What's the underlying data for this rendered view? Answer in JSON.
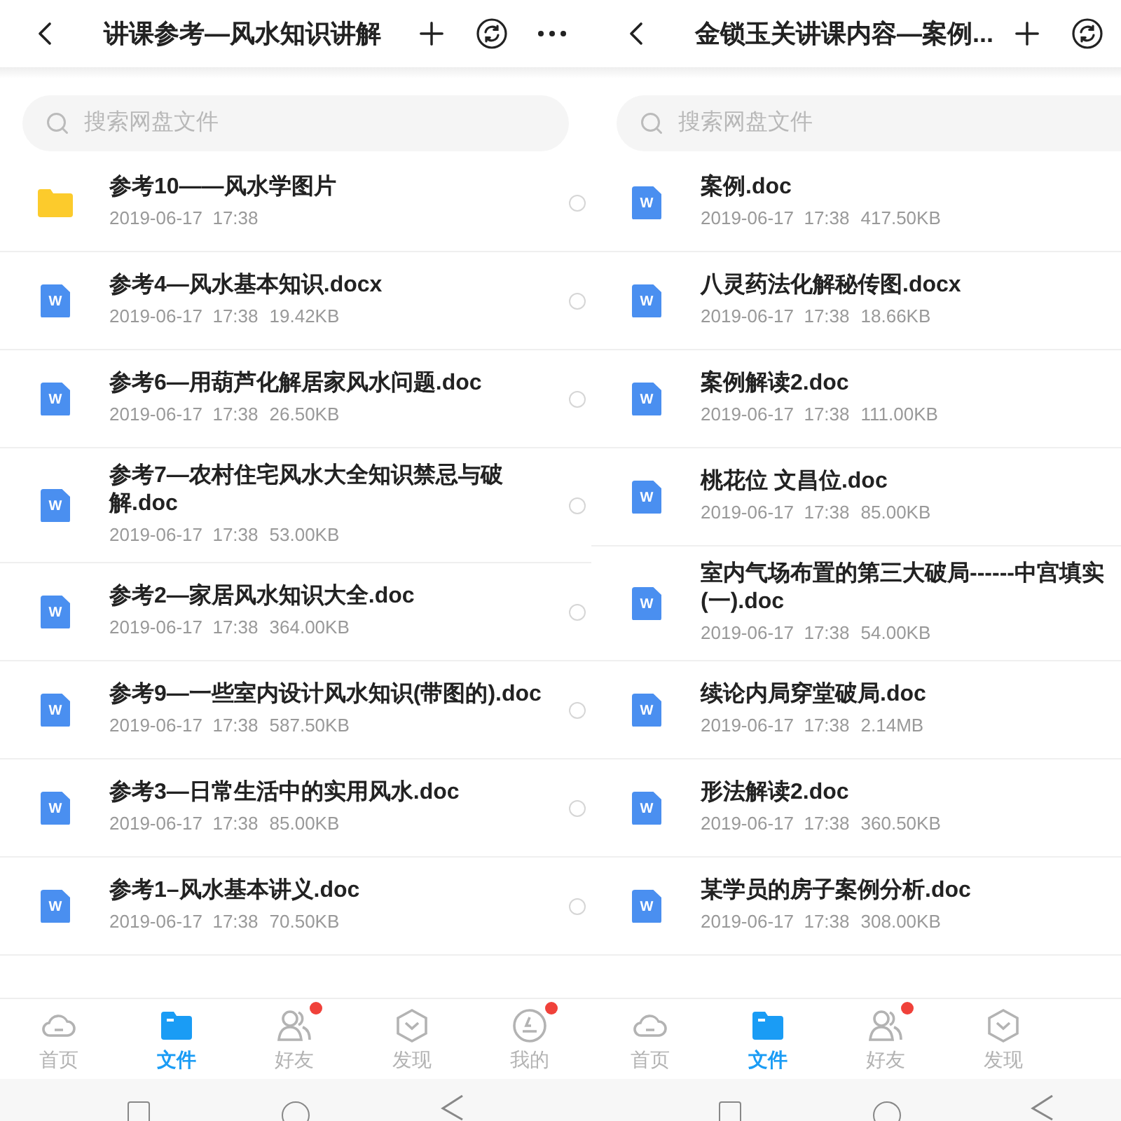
{
  "panels": [
    {
      "header": {
        "title": "讲课参考—风水知识讲解",
        "actions": [
          {
            "kind": "add"
          },
          {
            "kind": "sync"
          },
          {
            "kind": "more"
          }
        ]
      },
      "search": {
        "placeholder": "搜索网盘文件"
      },
      "files": [
        {
          "kind": "folder",
          "name": "参考10——风水学图片",
          "modified": "2019-06-17  17:38",
          "checked": false
        },
        {
          "kind": "word",
          "icon_label": "W",
          "name": "参考4—风水基本知识.docx",
          "modified": "2019-06-17  17:38",
          "size": "19.42KB",
          "checked": false
        },
        {
          "kind": "word",
          "icon_label": "W",
          "name": "参考6—用葫芦化解居家风水问题.doc",
          "modified": "2019-06-17  17:38",
          "size": "26.50KB",
          "checked": false
        },
        {
          "kind": "word",
          "icon_label": "W",
          "name": "参考7—农村住宅风水大全知识禁忌与破解.doc",
          "modified": "2019-06-17  17:38",
          "size": "53.00KB",
          "checked": false
        },
        {
          "kind": "word",
          "icon_label": "W",
          "name": "参考2—家居风水知识大全.doc",
          "modified": "2019-06-17  17:38",
          "size": "364.00KB",
          "checked": false
        },
        {
          "kind": "word",
          "icon_label": "W",
          "name": "参考9—一些室内设计风水知识(带图的).doc",
          "modified": "2019-06-17  17:38",
          "size": "587.50KB",
          "checked": false
        },
        {
          "kind": "word",
          "icon_label": "W",
          "name": "参考3—日常生活中的实用风水.doc",
          "modified": "2019-06-17  17:38",
          "size": "85.00KB",
          "checked": false
        },
        {
          "kind": "word",
          "icon_label": "W",
          "name": "参考1–风水基本讲义.doc",
          "modified": "2019-06-17  17:38",
          "size": "70.50KB",
          "checked": false
        }
      ],
      "tabs": [
        {
          "kind": "home",
          "label": "首页",
          "selected": false,
          "badge": false
        },
        {
          "kind": "files",
          "label": "文件",
          "selected": true,
          "badge": false
        },
        {
          "kind": "friends",
          "label": "好友",
          "selected": false,
          "badge": true
        },
        {
          "kind": "discover",
          "label": "发现",
          "selected": false,
          "badge": false
        },
        {
          "kind": "me",
          "label": "我的",
          "selected": false,
          "badge": true
        }
      ]
    },
    {
      "header": {
        "title": "金锁玉关讲课内容—案例...",
        "actions": [
          {
            "kind": "add"
          },
          {
            "kind": "sync"
          }
        ]
      },
      "search": {
        "placeholder": "搜索网盘文件"
      },
      "files": [
        {
          "kind": "word",
          "icon_label": "W",
          "name": "案例.doc",
          "modified": "2019-06-17  17:38",
          "size": "417.50KB"
        },
        {
          "kind": "word",
          "icon_label": "W",
          "name": "八灵药法化解秘传图.docx",
          "modified": "2019-06-17  17:38",
          "size": "18.66KB"
        },
        {
          "kind": "word",
          "icon_label": "W",
          "name": "案例解读2.doc",
          "modified": "2019-06-17  17:38",
          "size": "111.00KB"
        },
        {
          "kind": "word",
          "icon_label": "W",
          "name": "桃花位 文昌位.doc",
          "modified": "2019-06-17  17:38",
          "size": "85.00KB"
        },
        {
          "kind": "word",
          "icon_label": "W",
          "name": "室内气场布置的第三大破局------中宫填实(一).doc",
          "modified": "2019-06-17  17:38",
          "size": "54.00KB"
        },
        {
          "kind": "word",
          "icon_label": "W",
          "name": "续论内局穿堂破局.doc",
          "modified": "2019-06-17  17:38",
          "size": "2.14MB"
        },
        {
          "kind": "word",
          "icon_label": "W",
          "name": "形法解读2.doc",
          "modified": "2019-06-17  17:38",
          "size": "360.50KB"
        },
        {
          "kind": "word",
          "icon_label": "W",
          "name": "某学员的房子案例分析.doc",
          "modified": "2019-06-17  17:38",
          "size": "308.00KB"
        }
      ],
      "tabs": [
        {
          "kind": "home",
          "label": "首页",
          "selected": false,
          "badge": false
        },
        {
          "kind": "files",
          "label": "文件",
          "selected": true,
          "badge": false
        },
        {
          "kind": "friends",
          "label": "好友",
          "selected": false,
          "badge": true
        },
        {
          "kind": "discover",
          "label": "发现",
          "selected": false,
          "badge": false
        }
      ]
    }
  ]
}
